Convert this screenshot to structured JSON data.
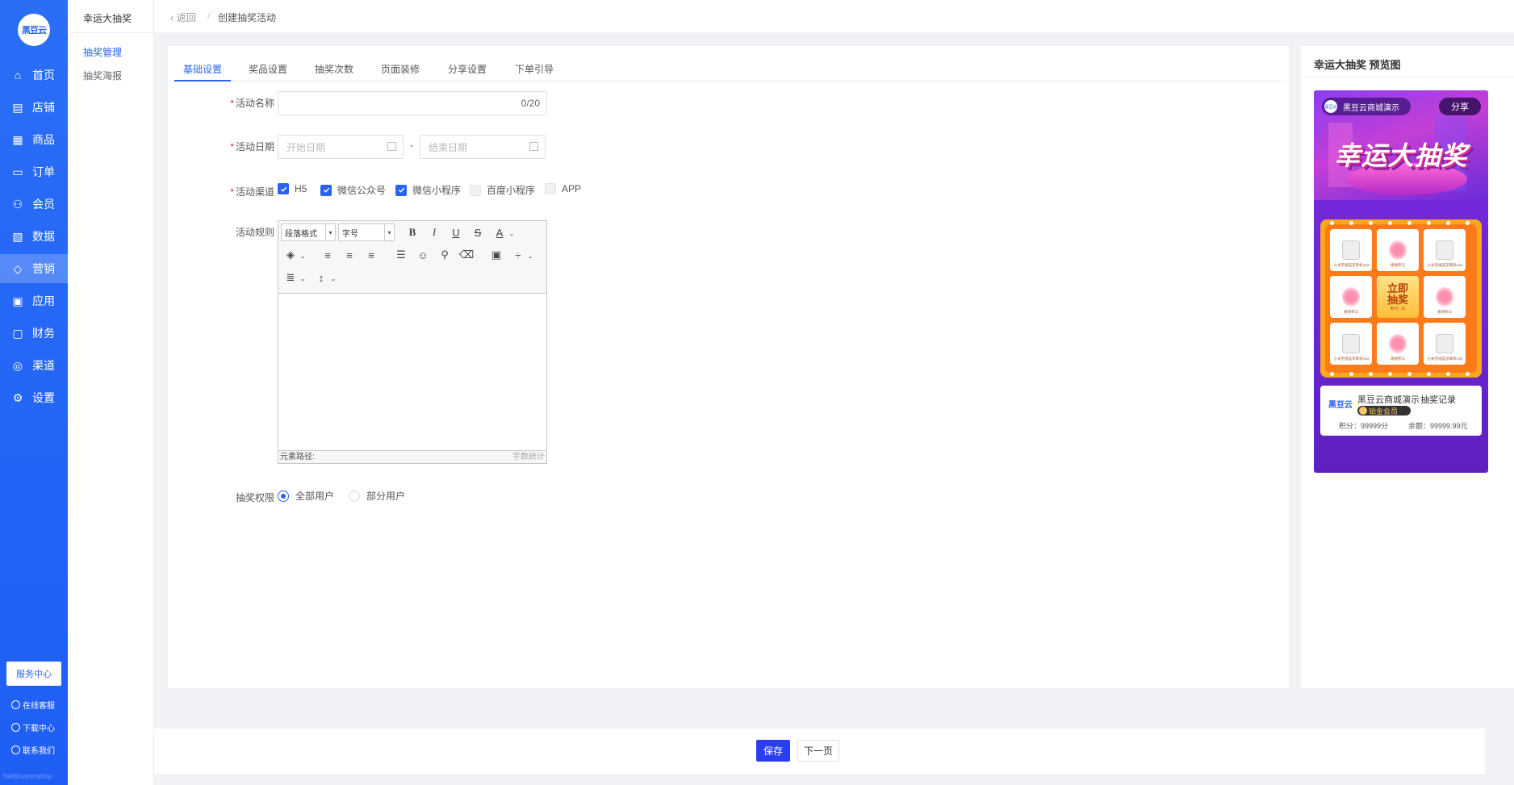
{
  "nav": {
    "logo": "黑豆云",
    "items": [
      {
        "label": "首页",
        "icon": "home-icon"
      },
      {
        "label": "店铺",
        "icon": "store-icon"
      },
      {
        "label": "商品",
        "icon": "goods-icon"
      },
      {
        "label": "订单",
        "icon": "order-icon"
      },
      {
        "label": "会员",
        "icon": "user-icon"
      },
      {
        "label": "数据",
        "icon": "chart-icon"
      },
      {
        "label": "营销",
        "icon": "tag-icon",
        "active": true
      },
      {
        "label": "应用",
        "icon": "app-icon"
      },
      {
        "label": "财务",
        "icon": "finance-icon"
      },
      {
        "label": "渠道",
        "icon": "channel-icon"
      },
      {
        "label": "设置",
        "icon": "gear-icon"
      }
    ],
    "service_center": "服务中心",
    "links": [
      "在线客服",
      "下载中心",
      "联系我们"
    ],
    "watermark": "heidouyunshop"
  },
  "subnav": {
    "title": "幸运大抽奖",
    "items": [
      {
        "label": "抽奖管理",
        "active": true
      },
      {
        "label": "抽奖海报"
      }
    ]
  },
  "header": {
    "back": "返回",
    "sep": "/",
    "current": "创建抽奖活动"
  },
  "tabs": [
    "基础设置",
    "奖品设置",
    "抽奖次数",
    "页面装修",
    "分享设置",
    "下单引导"
  ],
  "form": {
    "name_label": "活动名称",
    "name_count": "0/20",
    "date_label": "活动日期",
    "start_placeholder": "开始日期",
    "date_sep": "-",
    "end_placeholder": "结束日期",
    "channel_label": "活动渠道",
    "channels": [
      {
        "label": "H5",
        "checked": true
      },
      {
        "label": "微信公众号",
        "checked": true
      },
      {
        "label": "微信小程序",
        "checked": true
      },
      {
        "label": "百度小程序",
        "checked": false
      },
      {
        "label": "APP",
        "checked": false
      }
    ],
    "rule_label": "活动规则",
    "editor": {
      "para_format": "段落格式",
      "font_size": "字号",
      "path_label": "元素路径:",
      "word_count": "字数统计"
    },
    "perm_label": "抽奖权限",
    "perm_options": [
      {
        "label": "全部用户",
        "selected": true
      },
      {
        "label": "部分用户",
        "selected": false
      }
    ]
  },
  "preview": {
    "title": "幸运大抽奖 预览图",
    "shop_name": "黑豆云商城演示",
    "share": "分享",
    "banner_title": "幸运大抽奖",
    "grid": [
      {
        "text": "小米无线蓝牙耳机Air2",
        "type": "ear"
      },
      {
        "text": "谢谢参与",
        "type": "thx"
      },
      {
        "text": "小米无线蓝牙耳机Air2",
        "type": "ear"
      },
      {
        "text": "谢谢参与",
        "type": "thx"
      },
      {
        "text": "谢谢参与",
        "type": "thx"
      },
      {
        "text": "小米无线蓝牙耳机Air2",
        "type": "ear"
      },
      {
        "text": "谢谢参与",
        "type": "thx"
      },
      {
        "text": "小米无线蓝牙耳机Air2",
        "type": "ear"
      }
    ],
    "center_line1": "立即",
    "center_line2": "抽奖",
    "center_small": "积分: 10",
    "user_logo": "黑豆云",
    "user_name": "黑豆云商城演示",
    "member_level": "铂金会员",
    "records": "抽奖记录",
    "points": "积分：99999分",
    "balance": "余额：99999.99元"
  },
  "footer": {
    "save": "保存",
    "next": "下一页"
  },
  "colors": {
    "primary": "#2b63f1",
    "nav_bg": "#2b6ef6",
    "required": "#f5222d"
  }
}
